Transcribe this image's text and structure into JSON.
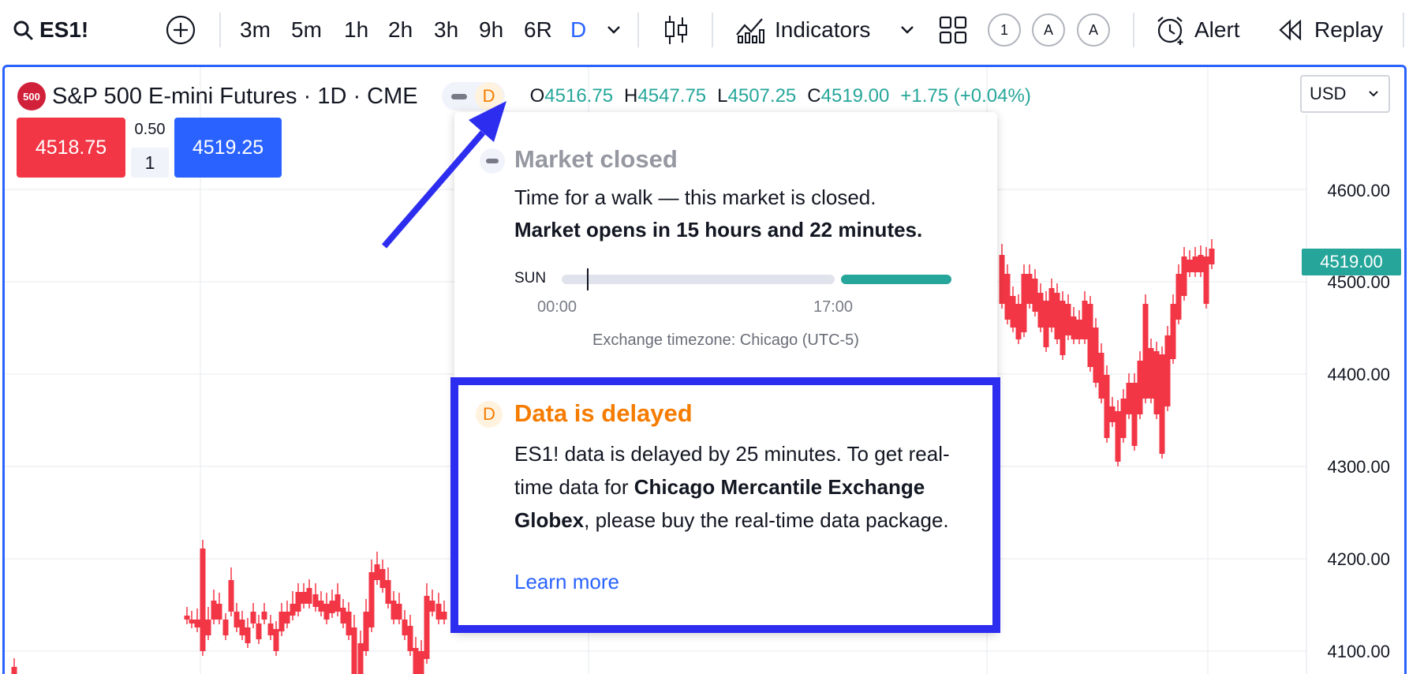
{
  "toolbar": {
    "symbol": "ES1!",
    "intervals": [
      "3m",
      "5m",
      "1h",
      "2h",
      "3h",
      "9h",
      "6R",
      "D"
    ],
    "active_interval": "D",
    "indicators_label": "Indicators",
    "layout_badges": [
      "1",
      "A",
      "A"
    ],
    "alert_label": "Alert",
    "replay_label": "Replay",
    "icons": [
      "search-icon",
      "add-symbol-icon",
      "chevron-down-icon",
      "candles-icon",
      "indicators-icon",
      "layout-grid-icon",
      "alarm-clock-icon",
      "replay-icon"
    ]
  },
  "legend": {
    "logo_text": "500",
    "title": "S&P 500 E-mini Futures · 1D · CME",
    "status_badge": "D",
    "ohlc": {
      "o_label": "O",
      "o": "4516.75",
      "h_label": "H",
      "h": "4547.75",
      "l_label": "L",
      "l": "4507.25",
      "c_label": "C",
      "c": "4519.00",
      "change": "+1.75 (+0.04%)"
    }
  },
  "trade": {
    "sell_price": "4518.75",
    "spread": "0.50",
    "quantity": "1",
    "buy_price": "4519.25"
  },
  "currency": "USD",
  "price_axis": {
    "labels": [
      "4600.00",
      "4500.00",
      "4400.00",
      "4300.00",
      "4200.00",
      "4100.00"
    ],
    "last_price": "4519.00"
  },
  "popup": {
    "market_closed": {
      "title": "Market closed",
      "line1": "Time for a walk — this market is closed.",
      "line2": "Market opens in 15 hours and 22 minutes.",
      "day": "SUN",
      "time_start": "00:00",
      "time_mid": "17:00",
      "timezone": "Exchange timezone: Chicago (UTC-5)"
    },
    "data_delayed": {
      "badge": "D",
      "title": "Data is delayed",
      "body_pre": "ES1! data is delayed by 25 minutes. To get real-time data for ",
      "body_bold": "Chicago Mercantile Exchange Globex",
      "body_post": ", please buy the real-time data package.",
      "link": "Learn more"
    }
  },
  "colors": {
    "up": "#26a69a",
    "down": "#f23645",
    "accent": "#2962ff",
    "delayed": "#f57c00",
    "annotation": "#2d2df0"
  }
}
